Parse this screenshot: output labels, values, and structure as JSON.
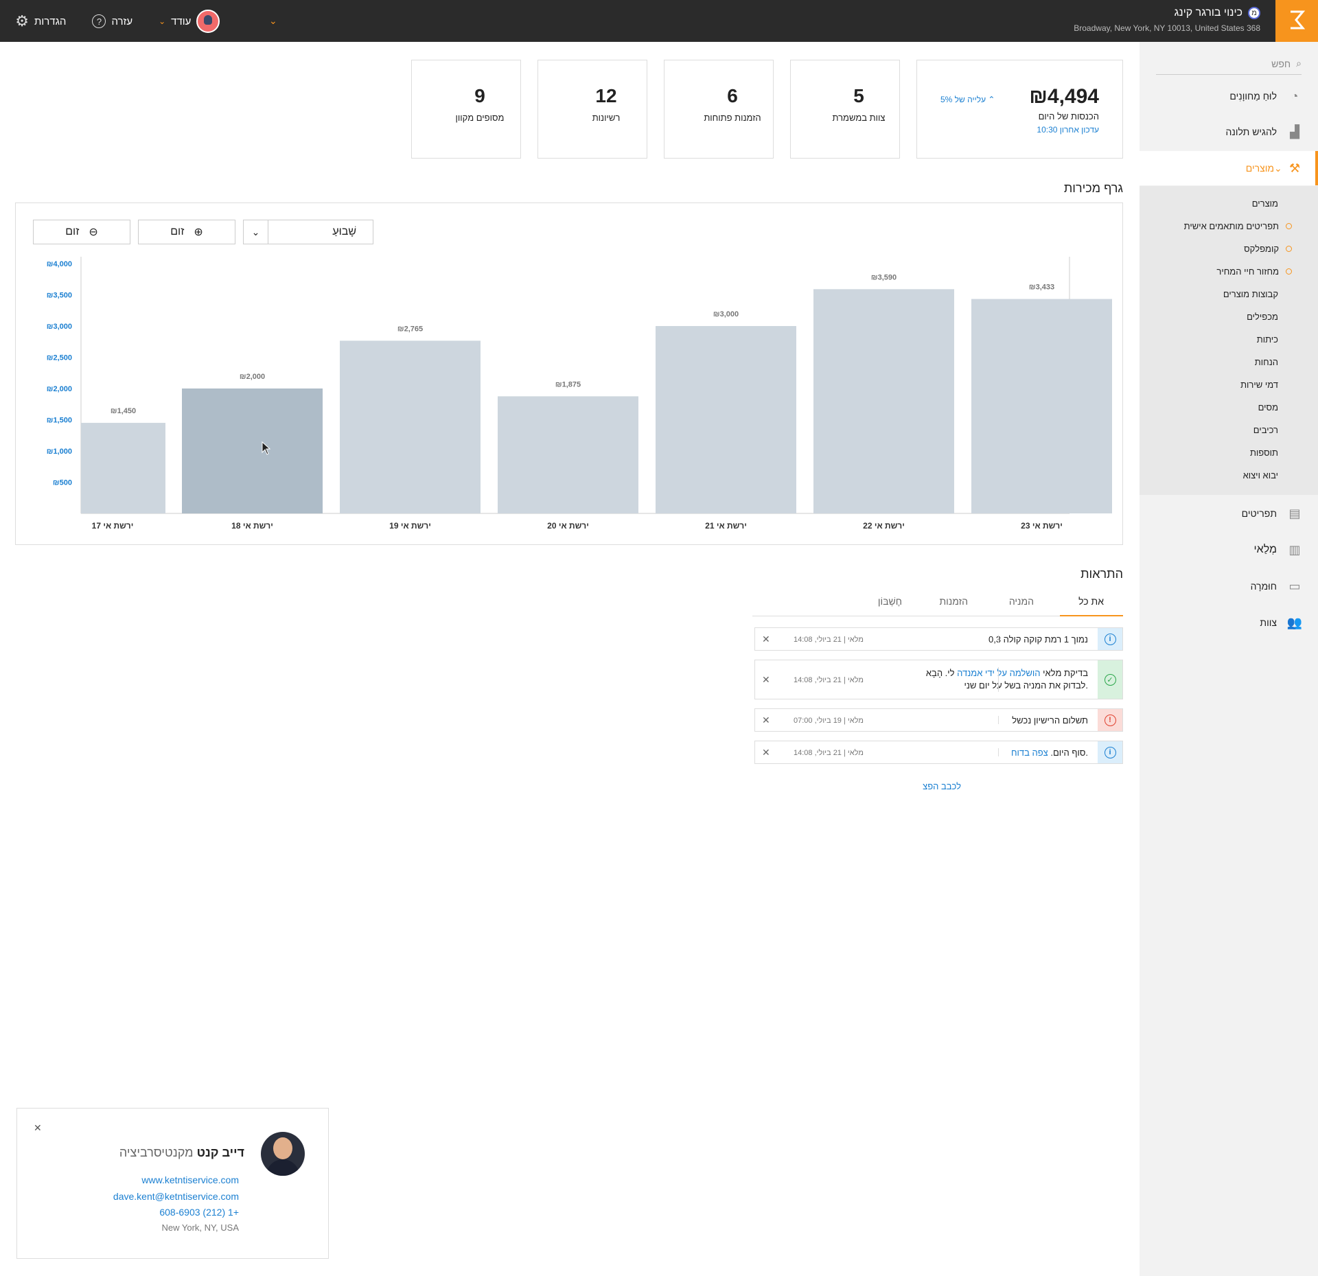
{
  "topbar": {
    "store_name": "כינוי בורגר קינג",
    "store_badge": "מ",
    "store_address": "368 Broadway, New York, NY 10013, United States",
    "settings_label": "הגדרות",
    "help_label": "עזרה",
    "more_label": "עודד"
  },
  "sidebar": {
    "search_placeholder": "חפש",
    "items": [
      {
        "label": "לוּחַ מַחווָנִים",
        "icon": "speedometer-icon"
      },
      {
        "label": "להגיש תלונה",
        "icon": "chart-icon"
      },
      {
        "label": "מוצרים",
        "icon": "hammer-icon"
      },
      {
        "label": "תפריטים",
        "icon": "menu-book-icon"
      },
      {
        "label": "מְלַאי",
        "icon": "clipboard-icon"
      },
      {
        "label": "חוּמרָה",
        "icon": "monitor-icon"
      },
      {
        "label": "צוות",
        "icon": "team-icon"
      }
    ],
    "sub_items": [
      {
        "label": "מוצרים",
        "dot": false
      },
      {
        "label": "תפריטים מותאמים אישית",
        "dot": true
      },
      {
        "label": "קומפלקס",
        "dot": true
      },
      {
        "label": "מחזור חיי המחיר",
        "dot": true
      },
      {
        "label": "קבוצות מוצרים",
        "dot": false
      },
      {
        "label": "מכפילים",
        "dot": false
      },
      {
        "label": "כיתות",
        "dot": false
      },
      {
        "label": "הנחות",
        "dot": false
      },
      {
        "label": "דמי שירות",
        "dot": false
      },
      {
        "label": "מסים",
        "dot": false
      },
      {
        "label": "רכיבים",
        "dot": false
      },
      {
        "label": "תוספות",
        "dot": false
      },
      {
        "label": "יבוא ויצוא",
        "dot": false
      }
    ]
  },
  "kpis": {
    "revenue": {
      "value": "₪4,494",
      "label": "הכנסות של היום",
      "updated": "עדכון אחרון 10:30",
      "rise": "עלייה של 5%"
    },
    "staff": {
      "value": "5",
      "label": "צוות במשמרת"
    },
    "orders": {
      "value": "6",
      "label": "הזמנות פתוחות"
    },
    "licenses": {
      "value": "12",
      "label": "רשיונות"
    },
    "terminals": {
      "value": "9",
      "label": "מסופים מקוון"
    }
  },
  "sales": {
    "title": "גרף מכירות",
    "period": "שָׁבוּעַ",
    "zoom_in": "זום",
    "zoom_out": "זום"
  },
  "chart_data": {
    "type": "bar",
    "categories": [
      "ירשת אי 17",
      "ירשת אי 18",
      "ירשת אי 19",
      "ירשת אי 20",
      "ירשת אי 21",
      "ירשת אי 22",
      "ירשת אי 23"
    ],
    "values": [
      1450,
      2000,
      2765,
      1875,
      3000,
      3590,
      3433
    ],
    "data_labels": [
      "₪1,450",
      "₪2,000",
      "₪2,765",
      "₪1,875",
      "₪3,000",
      "₪3,590",
      "₪3,433"
    ],
    "y_ticks": [
      500,
      1000,
      1500,
      2000,
      2500,
      3000,
      3500,
      4000
    ],
    "y_tick_labels": [
      "₪500",
      "₪1,000",
      "₪1,500",
      "₪2,000",
      "₪2,500",
      "₪3,000",
      "₪3,500",
      "₪4,000"
    ],
    "ylim": [
      0,
      4000
    ],
    "highlighted_index": 1,
    "colors": {
      "bar": "#cdd6de",
      "bar_highlight": "#aebcc8",
      "tick": "#1a7fd1"
    }
  },
  "notifications": {
    "title": "התראות",
    "tabs": [
      "את כל",
      "המניה",
      "הזמנות",
      "חֶשְׁבּוֹן"
    ],
    "items": [
      {
        "type": "info",
        "text": "נמוך 1 רמת קוקה קולה 0,3",
        "meta": "מלאי | 21 ביולי, 14:08"
      },
      {
        "type": "success",
        "text_a": "בדיקת מלאי ",
        "link": "הושלמה על ידי אמנדה",
        "text_b": " לי. הָבָא",
        "text_c": ".לבדוק את המניה בשל על יום שני",
        "meta": "מלאי | 21 ביולי, 14:08"
      },
      {
        "type": "error",
        "text": "תשלום הרישיון נכשל",
        "meta": "מלאי | 19 ביולי, 07:00"
      },
      {
        "type": "info",
        "text": ".סוף היום. ",
        "link": "צפה בדוח",
        "meta": "מלאי | 21 ביולי, 14:08"
      }
    ],
    "more": "לכבב הפצ"
  },
  "contact": {
    "first_name": "דייב קנט",
    "company": "מקנטיסרביציה",
    "website": "www.ketntiservice.com",
    "email": "dave.kent@ketntiservice.com",
    "phone": "+1 (212) 608-6903",
    "city": "New York, NY, USA"
  }
}
